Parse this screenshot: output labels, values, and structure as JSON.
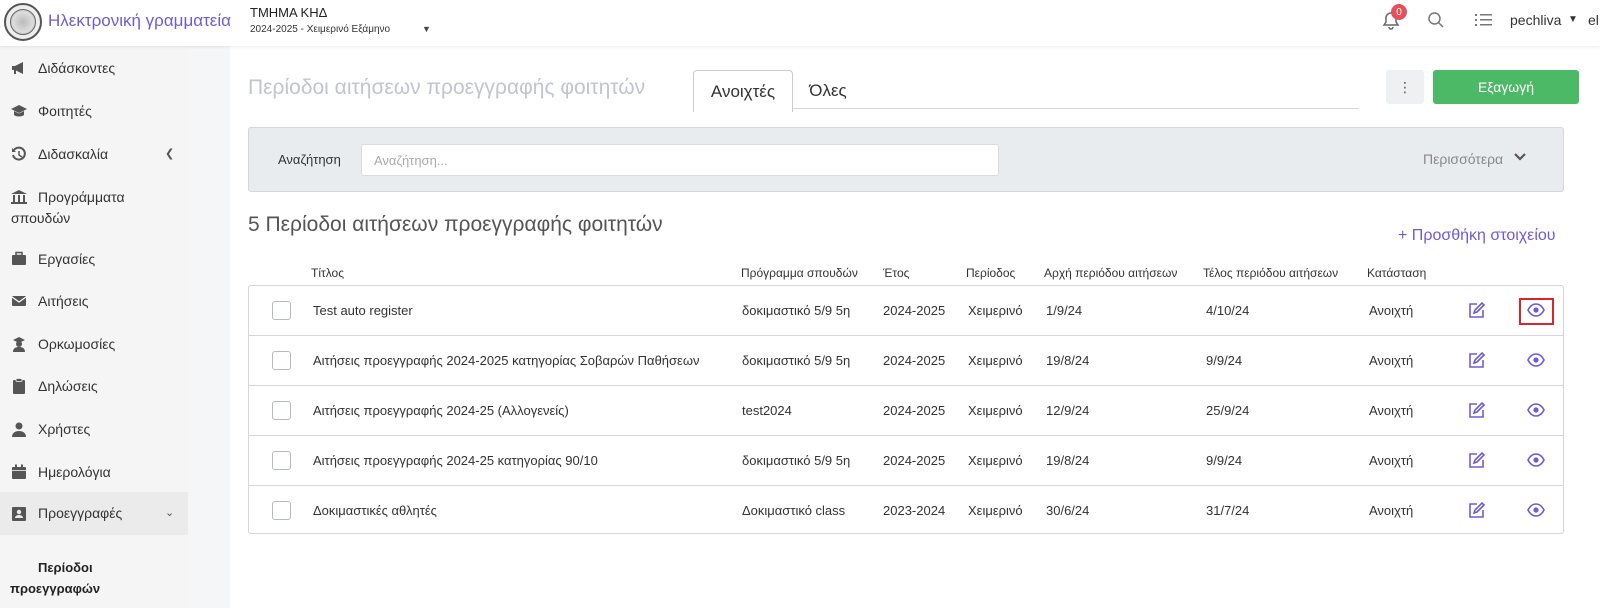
{
  "header": {
    "app_title": "Ηλεκτρονική γραμματεία",
    "department": "ΤΜΗΜΑ ΚΗΔ",
    "semester": "2024-2025 - Χειμερινό Εξάμηνο",
    "notifications_count": "0",
    "username": "pechliva",
    "language": "el"
  },
  "sidebar": {
    "items": [
      {
        "label": "Διδάσκοντες",
        "icon": "megaphone-icon"
      },
      {
        "label": "Φοιτητές",
        "icon": "graduation-cap-icon"
      },
      {
        "label": "Διδασκαλία",
        "icon": "history-icon"
      },
      {
        "label": "Προγράμματα σπουδών",
        "icon": "institution-icon"
      },
      {
        "label": "Εργασίες",
        "icon": "briefcase-icon"
      },
      {
        "label": "Αιτήσεις",
        "icon": "envelope-icon"
      },
      {
        "label": "Ορκωμοσίες",
        "icon": "graduate-icon"
      },
      {
        "label": "Δηλώσεις",
        "icon": "clipboard-icon"
      },
      {
        "label": "Χρήστες",
        "icon": "user-icon"
      },
      {
        "label": "Ημερολόγια",
        "icon": "calendar-icon"
      },
      {
        "label": "Προεγγραφές",
        "icon": "id-card-icon"
      }
    ],
    "sub_item": {
      "line1": "Περίοδοι",
      "line2": "προεγγραφών"
    }
  },
  "main": {
    "page_title": "Περίοδοι αιτήσεων προεγγραφής φοιτητών",
    "tabs": [
      {
        "label": "Ανοιχτές"
      },
      {
        "label": "Όλες"
      }
    ],
    "export_label": "Εξαγωγή",
    "search": {
      "label": "Αναζήτηση",
      "placeholder": "Αναζήτηση..."
    },
    "more_label": "Περισσότερα",
    "count_title": "5 Περίοδοι αιτήσεων προεγγραφής φοιτητών",
    "add_label": "+ Προσθήκη στοιχείου",
    "columns": [
      "Τίτλος",
      "Πρόγραμμα σπουδών",
      "Έτος",
      "Περίοδος",
      "Αρχή περιόδου αιτήσεων",
      "Τέλος περιόδου αιτήσεων",
      "Κατάσταση"
    ],
    "rows": [
      {
        "title": "Test auto register",
        "program": "δοκιμαστικό 5/9 5η",
        "year": "2024-2025",
        "period": "Χειμερινό",
        "start": "1/9/24",
        "end": "4/10/24",
        "status": "Ανοιχτή"
      },
      {
        "title": "Αιτήσεις προεγγραφής 2024-2025 κατηγορίας Σοβαρών Παθήσεων",
        "program": "δοκιμαστικό 5/9 5η",
        "year": "2024-2025",
        "period": "Χειμερινό",
        "start": "19/8/24",
        "end": "9/9/24",
        "status": "Ανοιχτή"
      },
      {
        "title": "Αιτήσεις προεγγραφής 2024-25 (Αλλογενείς)",
        "program": "test2024",
        "year": "2024-2025",
        "period": "Χειμερινό",
        "start": "12/9/24",
        "end": "25/9/24",
        "status": "Ανοιχτή"
      },
      {
        "title": "Αιτήσεις προεγγραφής 2024-25 κατηγορίας 90/10",
        "program": "δοκιμαστικό 5/9 5η",
        "year": "2024-2025",
        "period": "Χειμερινό",
        "start": "19/8/24",
        "end": "9/9/24",
        "status": "Ανοιχτή"
      },
      {
        "title": "Δοκιμαστικές αθλητές",
        "program": "Δοκιμαστικό class",
        "year": "2023-2024",
        "period": "Χειμερινό",
        "start": "30/6/24",
        "end": "31/7/24",
        "status": "Ανοιχτή"
      }
    ]
  },
  "colors": {
    "accent": "#6f5bd6",
    "export": "#4cb966",
    "badge": "#e6505a",
    "highlight": "#d7262c"
  }
}
